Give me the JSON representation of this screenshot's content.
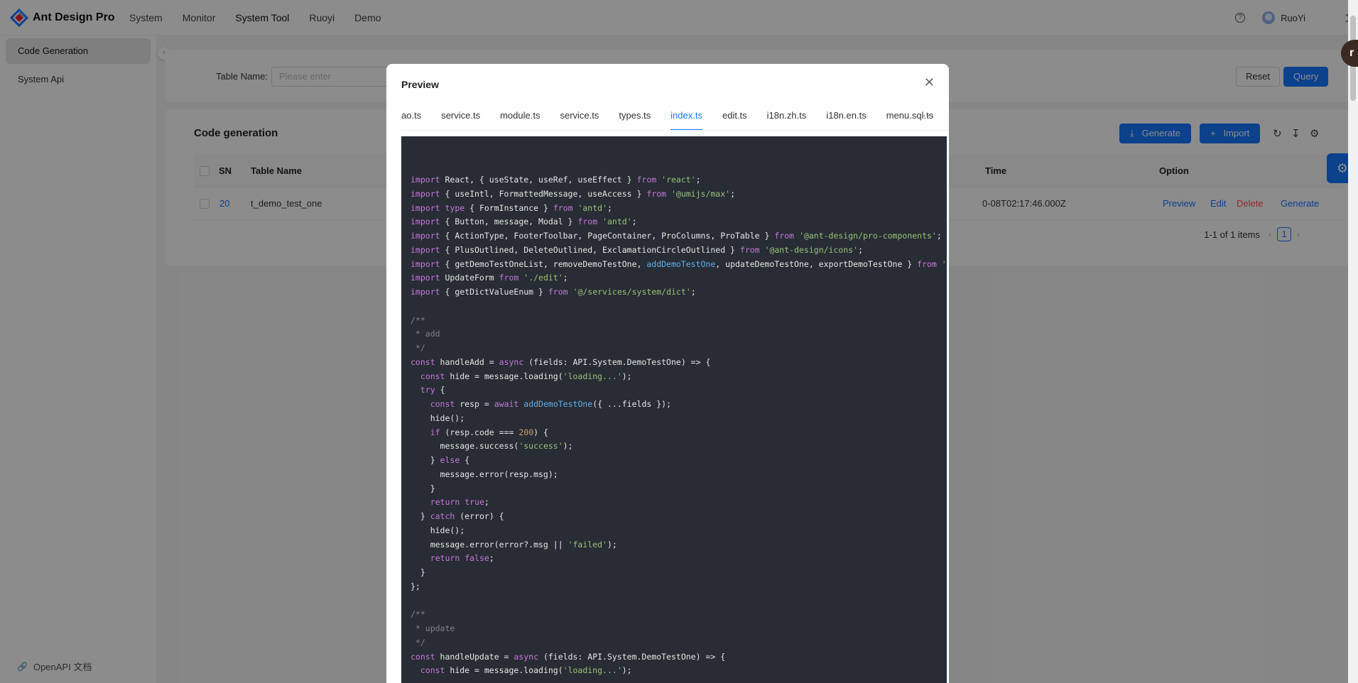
{
  "header": {
    "brand": "Ant Design Pro",
    "nav": [
      "System",
      "Monitor",
      "System Tool",
      "Ruoyi",
      "Demo"
    ],
    "active_nav": "System Tool",
    "user_name": "RuoYi",
    "lang_icon": "文"
  },
  "sidebar": {
    "items": [
      {
        "label": "Code Generation",
        "active": true
      },
      {
        "label": "System Api",
        "active": false
      }
    ],
    "footer": "OpenAPI 文档"
  },
  "search": {
    "label": "Table Name:",
    "placeholder": "Please enter",
    "reset": "Reset",
    "query": "Query"
  },
  "table": {
    "title": "Code generation",
    "generate": "Generate",
    "import": "Import",
    "columns": {
      "sn": "SN",
      "table_name": "Table Name",
      "time": "Time",
      "option": "Option"
    },
    "row": {
      "sn": "20",
      "table_name": "t_demo_test_one",
      "time": "0-08T02:17:46.000Z",
      "actions": {
        "preview": "Preview",
        "edit": "Edit",
        "delete": "Delete",
        "generate": "Generate"
      }
    },
    "pagination": {
      "summary": "1-1 of 1 items",
      "page": "1"
    }
  },
  "modal": {
    "title": "Preview",
    "tabs": [
      "ao.ts",
      "service.ts",
      "module.ts",
      "service.ts",
      "types.ts",
      "index.ts",
      "edit.ts",
      "i18n.zh.ts",
      "i18n.en.ts",
      "menu.sql.ts"
    ],
    "active_tab": "index.ts",
    "code_lines": [
      "import React, { useState, useRef, useEffect } from 'react';",
      "import { useIntl, FormattedMessage, useAccess } from '@umijs/max';",
      "import type { FormInstance } from 'antd';",
      "import { Button, message, Modal } from 'antd';",
      "import { ActionType, FooterToolbar, PageContainer, ProColumns, ProTable } from '@ant-design/pro-components';",
      "import { PlusOutlined, DeleteOutlined, ExclamationCircleOutlined } from '@ant-design/icons';",
      "import { getDemoTestOneList, removeDemoTestOne, addDemoTestOne, updateDemoTestOne, exportDemoTestOne } from '",
      "import UpdateForm from './edit';",
      "import { getDictValueEnum } from '@/services/system/dict';",
      "",
      "/**",
      " * add",
      " */",
      "const handleAdd = async (fields: API.System.DemoTestOne) => {",
      "  const hide = message.loading('loading...');",
      "  try {",
      "    const resp = await addDemoTestOne({ ...fields });",
      "    hide();",
      "    if (resp.code === 200) {",
      "      message.success('success');",
      "    } else {",
      "      message.error(resp.msg);",
      "    }",
      "    return true;",
      "  } catch (error) {",
      "    hide();",
      "    message.error(error?.msg || 'failed');",
      "    return false;",
      "  }",
      "};",
      "",
      "/**",
      " * update",
      " */",
      "const handleUpdate = async (fields: API.System.DemoTestOne) => {",
      "  const hide = message.loading('loading...');"
    ]
  },
  "colors": {
    "primary": "#1677ff",
    "danger": "#ff4d4f",
    "code_bg": "#282c34"
  },
  "icons": [
    "logo-icon",
    "help-icon",
    "user-avatar",
    "translate-icon",
    "collapse-icon",
    "link-icon",
    "download-icon",
    "plus-icon",
    "reload-icon",
    "density-icon",
    "settings-icon",
    "close-icon",
    "more-icon"
  ]
}
